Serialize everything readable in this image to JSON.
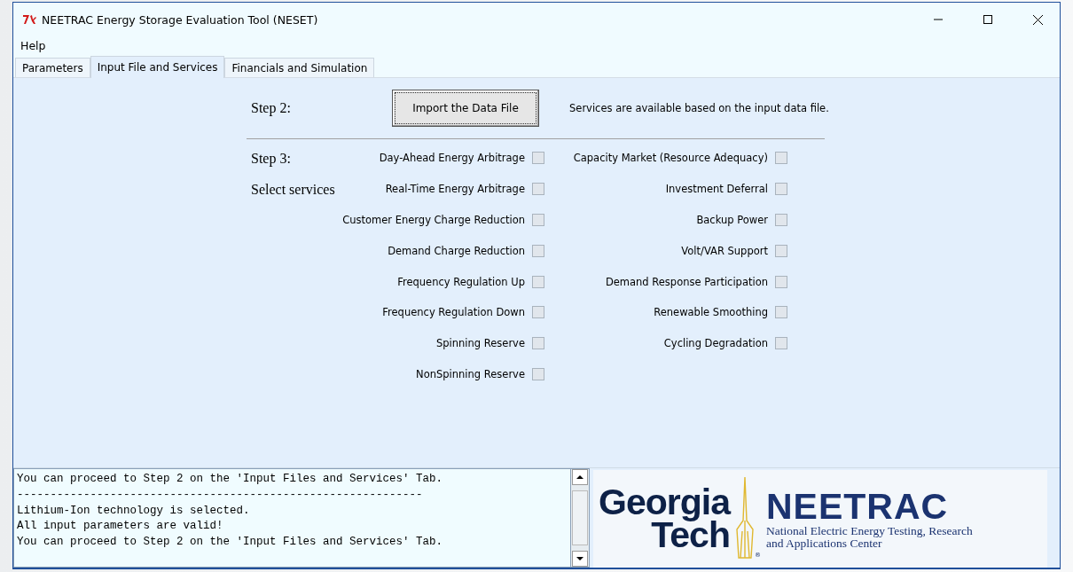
{
  "window": {
    "title": "NEETRAC Energy Storage Evaluation Tool (NESET)"
  },
  "menu": [
    "Help"
  ],
  "tabs": [
    {
      "label": "Parameters",
      "selected": false
    },
    {
      "label": "Input File and Services",
      "selected": true
    },
    {
      "label": "Financials and Simulation",
      "selected": false
    }
  ],
  "step2": {
    "label": "Step 2:",
    "button": "Import the Data File",
    "note": "Services are available based on the input data file."
  },
  "step3": {
    "label": "Step 3:",
    "sublabel": "Select services"
  },
  "services_left": [
    {
      "label": "Day-Ahead Energy Arbitrage",
      "checked": false
    },
    {
      "label": "Real-Time Energy Arbitrage",
      "checked": false
    },
    {
      "label": "Customer Energy Charge Reduction",
      "checked": false
    },
    {
      "label": "Demand Charge Reduction",
      "checked": false
    },
    {
      "label": "Frequency Regulation Up",
      "checked": false
    },
    {
      "label": "Frequency Regulation Down",
      "checked": false
    },
    {
      "label": "Spinning Reserve",
      "checked": false
    },
    {
      "label": "NonSpinning Reserve",
      "checked": false
    }
  ],
  "services_right": [
    {
      "label": "Capacity Market (Resource Adequacy)",
      "checked": false
    },
    {
      "label": "Investment Deferral",
      "checked": false
    },
    {
      "label": "Backup Power",
      "checked": false
    },
    {
      "label": "Volt/VAR Support",
      "checked": false
    },
    {
      "label": "Demand Response Participation",
      "checked": false
    },
    {
      "label": "Renewable Smoothing",
      "checked": false
    },
    {
      "label": "Cycling Degradation",
      "checked": false
    }
  ],
  "log": [
    "You can proceed to Step 2 on the 'Input Files and Services' Tab.",
    "-------------------------------------------------------------",
    "Lithium-Ion technology is selected.",
    "All input parameters are valid!",
    "You can proceed to Step 2 on the 'Input Files and Services' Tab."
  ],
  "logo": {
    "left_line1": "Georgia",
    "left_line2": "Tech",
    "registered": "®",
    "right_title": "NEETRAC",
    "right_line1": "National Electric Energy Testing, Research",
    "right_line2": "and Applications Center"
  }
}
